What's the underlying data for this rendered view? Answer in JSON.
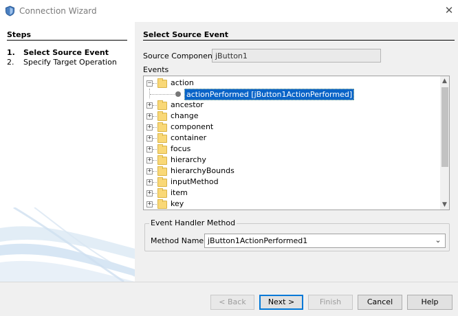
{
  "window": {
    "title": "Connection Wizard",
    "close_icon": "close-icon",
    "app_icon": "shield-icon"
  },
  "steps": {
    "heading": "Steps",
    "items": [
      {
        "number": "1.",
        "label": "Select Source Event",
        "current": true
      },
      {
        "number": "2.",
        "label": "Specify Target Operation",
        "current": false
      }
    ]
  },
  "main": {
    "title": "Select Source Event",
    "source_component_label": "Source Component:",
    "source_component_value": "jButton1",
    "events_label": "Events",
    "tree": {
      "nodes": [
        {
          "label": "action",
          "expanded": true
        },
        {
          "label": "ancestor",
          "expanded": false
        },
        {
          "label": "change",
          "expanded": false
        },
        {
          "label": "component",
          "expanded": false
        },
        {
          "label": "container",
          "expanded": false
        },
        {
          "label": "focus",
          "expanded": false
        },
        {
          "label": "hierarchy",
          "expanded": false
        },
        {
          "label": "hierarchyBounds",
          "expanded": false
        },
        {
          "label": "inputMethod",
          "expanded": false
        },
        {
          "label": "item",
          "expanded": false
        },
        {
          "label": "key",
          "expanded": false
        }
      ],
      "selected_child": "actionPerformed [jButton1ActionPerformed]",
      "expand_glyph": "+",
      "collapse_glyph": "−"
    },
    "handler_group": {
      "legend": "Event Handler Method",
      "method_name_label": "Method Name:",
      "method_name_value": "jButton1ActionPerformed1"
    }
  },
  "buttons": {
    "back": "< Back",
    "next": "Next >",
    "finish": "Finish",
    "cancel": "Cancel",
    "help": "Help"
  },
  "colors": {
    "selection": "#0a64c8",
    "folder": "#f9d877",
    "default_button_border": "#0078d7"
  }
}
